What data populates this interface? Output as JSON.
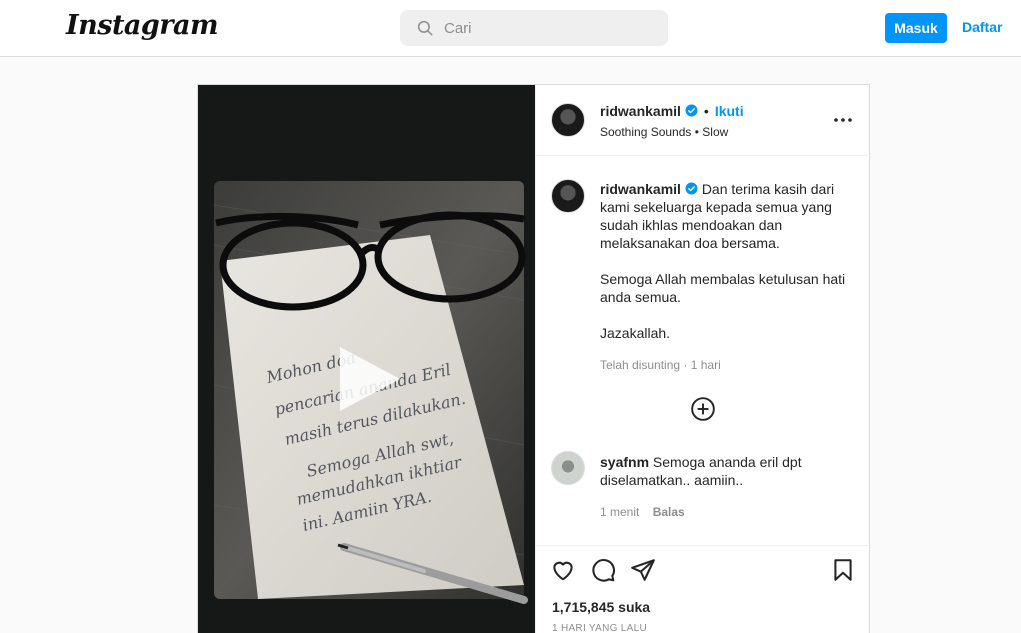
{
  "header": {
    "logo": "Instagram",
    "search_placeholder": "Cari",
    "login_label": "Masuk",
    "signup_label": "Daftar"
  },
  "media": {
    "handwriting": [
      "Mohon doa",
      "pencarian ananda Eril",
      "masih terus dilakukan.",
      "Semoga Allah swt,",
      "memudahkan ikhtiar",
      "ini. Aamiin YRA."
    ]
  },
  "post": {
    "author": "ridwankamil",
    "follow_label": "Ikuti",
    "audio": "Soothing Sounds • Slow",
    "caption": {
      "username": "ridwankamil",
      "lines": [
        "Dan terima kasih dari",
        "kami sekeluarga kepada semua yang",
        "sudah ikhlas mendoakan dan",
        "melaksanakan doa bersama.",
        "",
        "Semoga Allah membalas ketulusan hati",
        "anda semua.",
        "",
        "Jazakallah."
      ],
      "meta": "Telah disunting · 1 hari"
    },
    "comment": {
      "username": "syafnm",
      "text_line1": "Semoga ananda eril dpt",
      "text_line2": "diselamatkan.. aamiin..",
      "time": "1 menit",
      "reply_label": "Balas"
    },
    "likes": "1,715,845 suka",
    "date": "1 HARI YANG LALU"
  },
  "icons": {
    "search": "search-icon",
    "verified": "verified-badge-icon",
    "more": "more-options-icon",
    "load_more": "plus-circle-icon",
    "like": "heart-icon",
    "comment": "comment-icon",
    "share": "send-icon",
    "save": "bookmark-icon",
    "play": "play-icon"
  },
  "colors": {
    "accent": "#0095f6",
    "text": "#262626",
    "muted": "#8e8e8e",
    "border": "#dbdbdb"
  }
}
